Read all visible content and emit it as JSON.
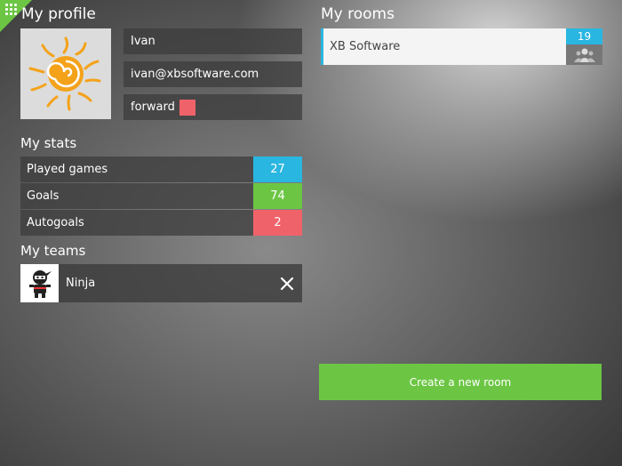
{
  "colors": {
    "accent_green": "#6cc644",
    "accent_blue": "#29b6e0",
    "accent_red": "#f0626a",
    "position_swatch": "#f0626a"
  },
  "menu": {
    "icon": "grid-menu-icon"
  },
  "profile": {
    "title": "My profile",
    "avatar_icon": "sun-avatar-icon",
    "name": "Ivan",
    "email": "ivan@xbsoftware.com",
    "position": "forward"
  },
  "stats": {
    "title": "My stats",
    "items": [
      {
        "label": "Played games",
        "value": "27",
        "color": "#29b6e0"
      },
      {
        "label": "Goals",
        "value": "74",
        "color": "#6cc644"
      },
      {
        "label": "Autogoals",
        "value": "2",
        "color": "#f0626a"
      }
    ]
  },
  "teams": {
    "title": "My teams",
    "items": [
      {
        "name": "Ninja",
        "avatar_icon": "ninja-avatar-icon",
        "remove_icon": "close-icon"
      }
    ]
  },
  "rooms": {
    "title": "My rooms",
    "items": [
      {
        "name": "XB Software",
        "count": "19",
        "icon": "users-icon"
      }
    ]
  },
  "create_room_label": "Create a new room"
}
